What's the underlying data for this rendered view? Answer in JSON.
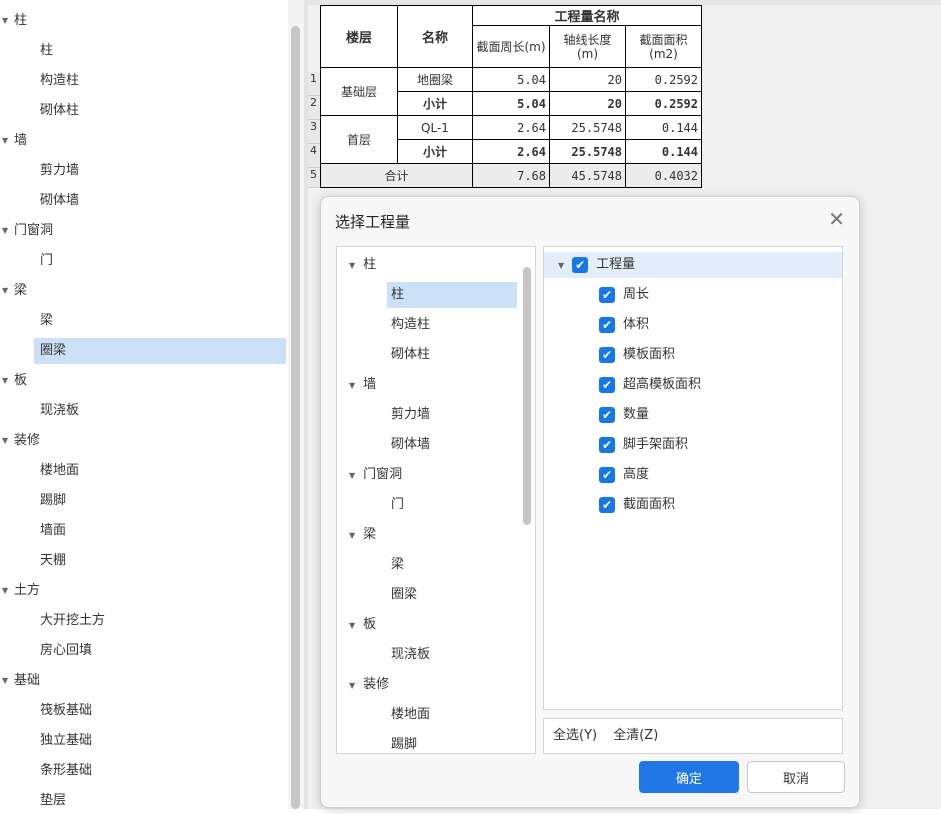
{
  "left_tree": [
    {
      "label": "柱",
      "level": 0
    },
    {
      "label": "柱",
      "level": 1
    },
    {
      "label": "构造柱",
      "level": 1
    },
    {
      "label": "砌体柱",
      "level": 1
    },
    {
      "label": "墙",
      "level": 0
    },
    {
      "label": "剪力墙",
      "level": 1
    },
    {
      "label": "砌体墙",
      "level": 1
    },
    {
      "label": "门窗洞",
      "level": 0
    },
    {
      "label": "门",
      "level": 1
    },
    {
      "label": "梁",
      "level": 0
    },
    {
      "label": "梁",
      "level": 1
    },
    {
      "label": "圈梁",
      "level": 1,
      "selected": true
    },
    {
      "label": "板",
      "level": 0
    },
    {
      "label": "现浇板",
      "level": 1
    },
    {
      "label": "装修",
      "level": 0
    },
    {
      "label": "楼地面",
      "level": 1
    },
    {
      "label": "踢脚",
      "level": 1
    },
    {
      "label": "墙面",
      "level": 1
    },
    {
      "label": "天棚",
      "level": 1
    },
    {
      "label": "土方",
      "level": 0
    },
    {
      "label": "大开挖土方",
      "level": 1
    },
    {
      "label": "房心回填",
      "level": 1
    },
    {
      "label": "基础",
      "level": 0
    },
    {
      "label": "筏板基础",
      "level": 1
    },
    {
      "label": "独立基础",
      "level": 1
    },
    {
      "label": "条形基础",
      "level": 1
    },
    {
      "label": "垫层",
      "level": 1
    }
  ],
  "table": {
    "h_floor": "楼层",
    "h_name": "名称",
    "h_group": "工程量名称",
    "h_c1": "截面周长(m)",
    "h_c2": "轴线长度(m)",
    "h_c3": "截面面积(m2)",
    "row_numbers": [
      "1",
      "2",
      "3",
      "4",
      "5"
    ],
    "g1_floor": "基础层",
    "g2_floor": "首层",
    "r1": {
      "name": "地圈梁",
      "c1": "5.04",
      "c2": "20",
      "c3": "0.2592"
    },
    "r2": {
      "name": "小计",
      "c1": "5.04",
      "c2": "20",
      "c3": "0.2592"
    },
    "r3": {
      "name": "QL-1",
      "c1": "2.64",
      "c2": "25.5748",
      "c3": "0.144"
    },
    "r4": {
      "name": "小计",
      "c1": "2.64",
      "c2": "25.5748",
      "c3": "0.144"
    },
    "r5": {
      "name": "合计",
      "c1": "7.68",
      "c2": "45.5748",
      "c3": "0.4032"
    }
  },
  "dialog": {
    "title": "选择工程量",
    "close": "✕",
    "tree": [
      {
        "label": "柱",
        "level": 0
      },
      {
        "label": "柱",
        "level": 1,
        "selected": true
      },
      {
        "label": "构造柱",
        "level": 1
      },
      {
        "label": "砌体柱",
        "level": 1
      },
      {
        "label": "墙",
        "level": 0
      },
      {
        "label": "剪力墙",
        "level": 1
      },
      {
        "label": "砌体墙",
        "level": 1
      },
      {
        "label": "门窗洞",
        "level": 0
      },
      {
        "label": "门",
        "level": 1
      },
      {
        "label": "梁",
        "level": 0
      },
      {
        "label": "梁",
        "level": 1
      },
      {
        "label": "圈梁",
        "level": 1
      },
      {
        "label": "板",
        "level": 0
      },
      {
        "label": "现浇板",
        "level": 1
      },
      {
        "label": "装修",
        "level": 0
      },
      {
        "label": "楼地面",
        "level": 1
      },
      {
        "label": "踢脚",
        "level": 1
      }
    ],
    "quantities_root": "工程量",
    "quantities": [
      "周长",
      "体积",
      "模板面积",
      "超高模板面积",
      "数量",
      "脚手架面积",
      "高度",
      "截面面积"
    ],
    "select_all": "全选(Y)",
    "clear_all": "全清(Z)",
    "ok": "确定",
    "cancel": "取消"
  }
}
